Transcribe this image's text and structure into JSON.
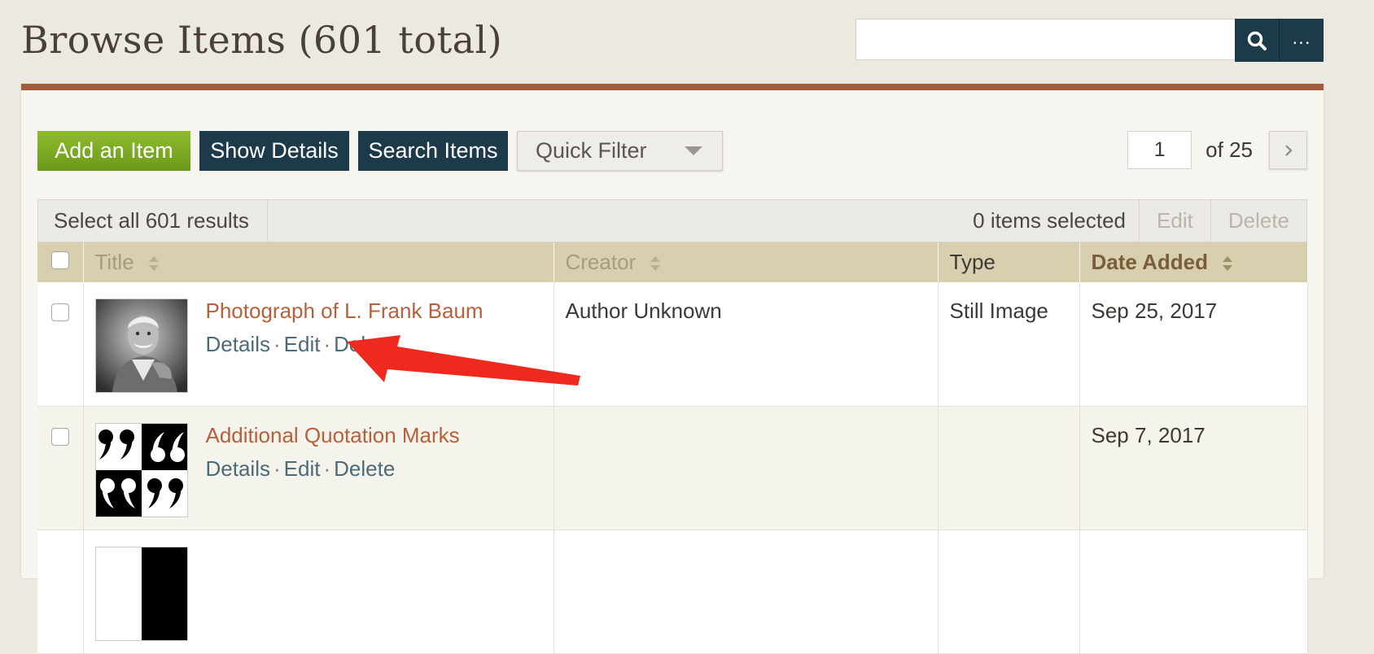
{
  "header": {
    "title": "Browse Items (601 total)"
  },
  "search": {
    "value": "",
    "advanced_label": "..."
  },
  "toolbar": {
    "add_label": "Add an Item",
    "details_label": "Show Details",
    "search_label": "Search Items",
    "filter_label": "Quick Filter"
  },
  "pagination": {
    "current": "1",
    "of_label": "of 25"
  },
  "batch": {
    "select_all_label": "Select all 601 results",
    "selected_label": "0 items selected",
    "edit_label": "Edit",
    "delete_label": "Delete"
  },
  "table": {
    "columns": {
      "title": "Title",
      "creator": "Creator",
      "type": "Type",
      "date": "Date Added"
    },
    "rows": [
      {
        "title": "Photograph of L. Frank Baum",
        "details": "Details",
        "edit": "Edit",
        "delete": "Delete",
        "creator": "Author Unknown",
        "type": "Still Image",
        "date": "Sep 25, 2017"
      },
      {
        "title": "Additional Quotation Marks",
        "details": "Details",
        "edit": "Edit",
        "delete": "Delete",
        "creator": "",
        "type": "",
        "date": "Sep 7, 2017"
      },
      {
        "title": "",
        "details": "",
        "edit": "",
        "delete": "",
        "creator": "",
        "type": "",
        "date": ""
      }
    ]
  },
  "colors": {
    "accent": "#a25b3c",
    "button_dark": "#1d3a4b",
    "button_green": "#7aa722",
    "link": "#b85f3b",
    "arrow": "#ee2a1e"
  },
  "icons": {
    "search": "search-icon",
    "next": "chevron-right-icon",
    "sort": "sort-icon"
  }
}
